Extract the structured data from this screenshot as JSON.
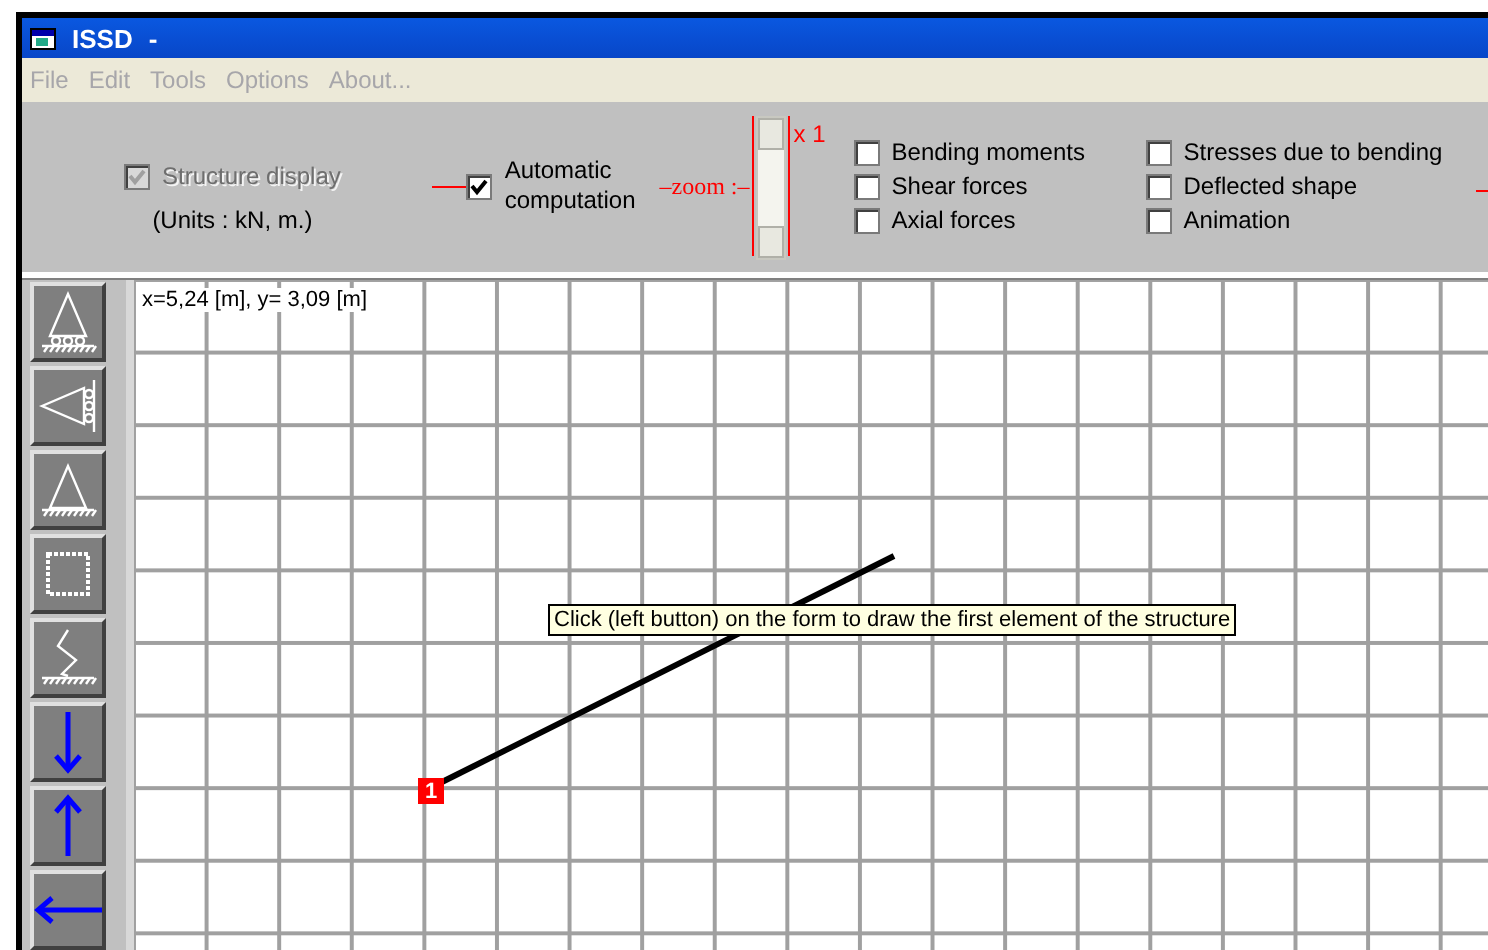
{
  "window": {
    "title": "ISSD",
    "subtitle": "-"
  },
  "menu": [
    {
      "label": "File",
      "disabled": true
    },
    {
      "label": "Edit",
      "disabled": true
    },
    {
      "label": "Tools",
      "disabled": true
    },
    {
      "label": "Options",
      "disabled": true
    },
    {
      "label": "About...",
      "disabled": true
    }
  ],
  "toolbar": {
    "structure_display": {
      "label": "Structure display",
      "checked": true,
      "disabled": true
    },
    "units": "(Units : kN, m.)",
    "automatic_computation": {
      "label_lines": [
        "Automatic",
        "computation"
      ],
      "checked": true,
      "disabled": false
    },
    "zoom_label": "–zoom :–",
    "zoom_value": "x 1",
    "results": [
      {
        "label": "Bending moments",
        "checked": false
      },
      {
        "label": "Shear forces",
        "checked": false
      },
      {
        "label": "Axial forces",
        "checked": false
      },
      {
        "label": "Stresses due to bending",
        "checked": false
      },
      {
        "label": "Deflected shape",
        "checked": false
      },
      {
        "label": "Animation",
        "checked": false
      }
    ]
  },
  "tools": [
    {
      "kind": "roller-support"
    },
    {
      "kind": "side-roller-support"
    },
    {
      "kind": "pin-support"
    },
    {
      "kind": "fixed-support"
    },
    {
      "kind": "spring-support"
    },
    {
      "kind": "down-arrow"
    },
    {
      "kind": "up-arrow"
    },
    {
      "kind": "left-arrow"
    }
  ],
  "canvas": {
    "coordinates": "x=5,24 [m], y= 3,09 [m]",
    "node_label": "1",
    "tooltip": "Click (left button) on the form to draw the first element of the structure"
  }
}
